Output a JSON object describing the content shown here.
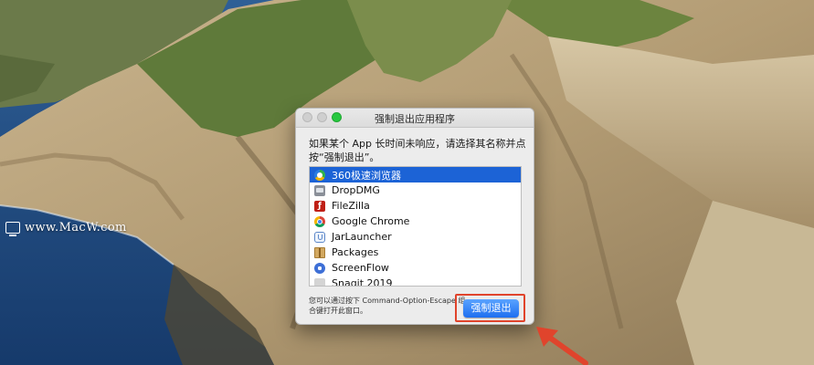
{
  "watermark": {
    "text": "www.MacW.com"
  },
  "dialog": {
    "title": "强制退出应用程序",
    "prompt": "如果某个 App 长时间未响应，请选择其名称并点按“强制退出”。",
    "apps": [
      {
        "name": "360极速浏览器",
        "icon": "360-browser-icon",
        "selected": true
      },
      {
        "name": "DropDMG",
        "icon": "dropdmg-icon",
        "selected": false
      },
      {
        "name": "FileZilla",
        "icon": "filezilla-icon",
        "selected": false
      },
      {
        "name": "Google Chrome",
        "icon": "chrome-icon",
        "selected": false
      },
      {
        "name": "JarLauncher",
        "icon": "jarlauncher-icon",
        "selected": false
      },
      {
        "name": "Packages",
        "icon": "packages-icon",
        "selected": false
      },
      {
        "name": "ScreenFlow",
        "icon": "screenflow-icon",
        "selected": false
      },
      {
        "name": "Snagit 2019",
        "icon": "snagit-icon",
        "selected": false
      }
    ],
    "footnote": "您可以通过按下 Command-Option-Escape 组合键打开此窗口。",
    "force_quit_label": "强制退出"
  },
  "colors": {
    "selection": "#1c63d6",
    "button": "#1d6ef0",
    "highlight_annotation": "#e0442c"
  }
}
